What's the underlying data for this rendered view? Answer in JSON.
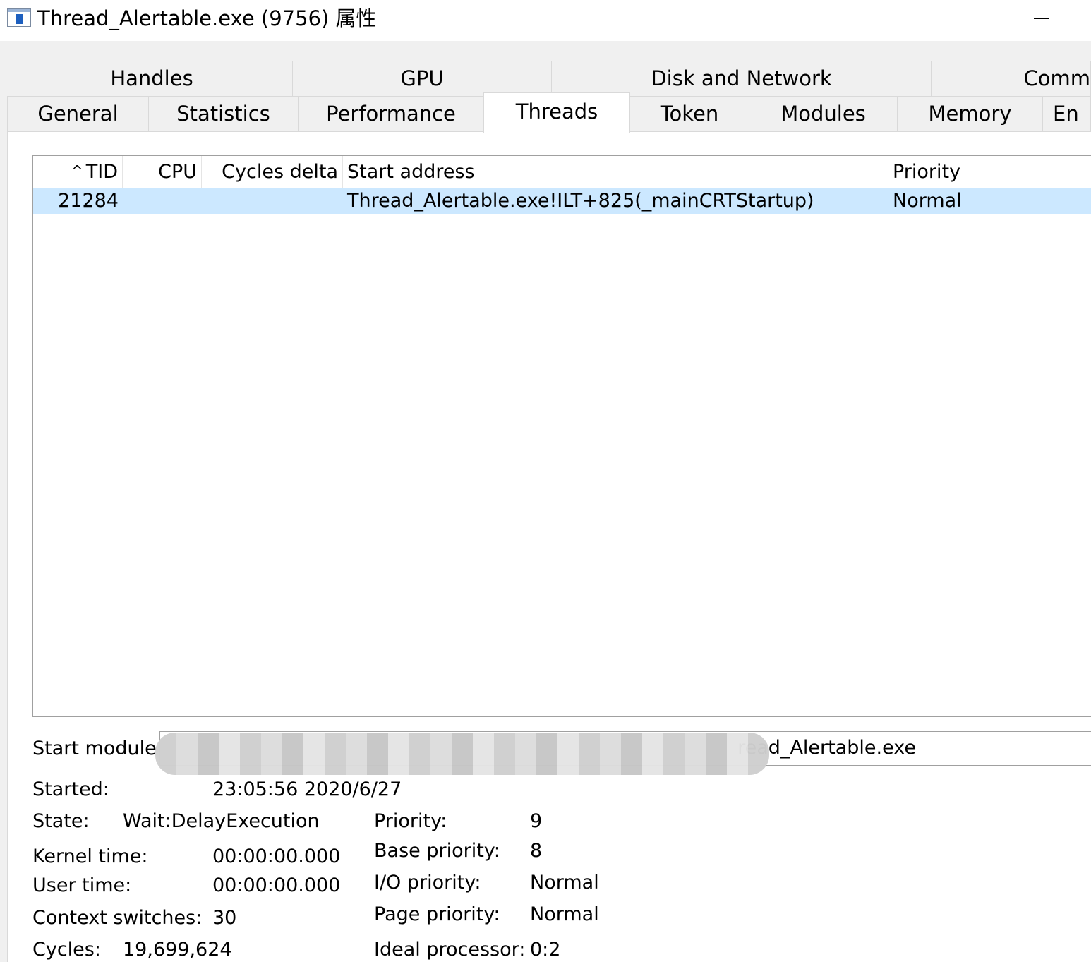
{
  "window": {
    "title": "Thread_Alertable.exe (9756) 属性"
  },
  "tabs_row1": [
    {
      "label": "Handles"
    },
    {
      "label": "GPU"
    },
    {
      "label": "Disk and Network"
    },
    {
      "label": "Comm"
    }
  ],
  "tabs_row2": [
    {
      "label": "General"
    },
    {
      "label": "Statistics"
    },
    {
      "label": "Performance"
    },
    {
      "label": "Threads",
      "active": true
    },
    {
      "label": "Token"
    },
    {
      "label": "Modules"
    },
    {
      "label": "Memory"
    },
    {
      "label": "En"
    }
  ],
  "threads_table": {
    "sort_indicator": "^",
    "columns": [
      "TID",
      "CPU",
      "Cycles delta",
      "Start address",
      "Priority"
    ],
    "rows": [
      {
        "tid": "21284",
        "cpu": "",
        "cycles_delta": "",
        "start_address": "Thread_Alertable.exe!ILT+825(_mainCRTStartup)",
        "priority": "Normal",
        "selected": true
      }
    ]
  },
  "details": {
    "start_module_label": "Start module:",
    "start_module_value_visible": "read_Alertable.exe",
    "started_label": "Started:",
    "started_value": "23:05:56 2020/6/27",
    "state_label": "State:",
    "state_value": "Wait:DelayExecution",
    "kernel_time_label": "Kernel time:",
    "kernel_time_value": "00:00:00.000",
    "user_time_label": "User time:",
    "user_time_value": "00:00:00.000",
    "context_switches_label": "Context switches:",
    "context_switches_value": "30",
    "cycles_label": "Cycles:",
    "cycles_value": "19,699,624",
    "priority_label": "Priority:",
    "priority_value": "9",
    "base_priority_label": "Base priority:",
    "base_priority_value": "8",
    "io_priority_label": "I/O priority:",
    "io_priority_value": "Normal",
    "page_priority_label": "Page priority:",
    "page_priority_value": "Normal",
    "ideal_processor_label": "Ideal processor:",
    "ideal_processor_value": "0:2"
  },
  "colors": {
    "selection": "#cce8ff",
    "window_bg": "#f0f0f0",
    "panel_bg": "#ffffff",
    "app_icon_blue": "#1d5fbf"
  },
  "icons": {
    "app": "window-app-icon",
    "minimize": "minimize-icon"
  }
}
